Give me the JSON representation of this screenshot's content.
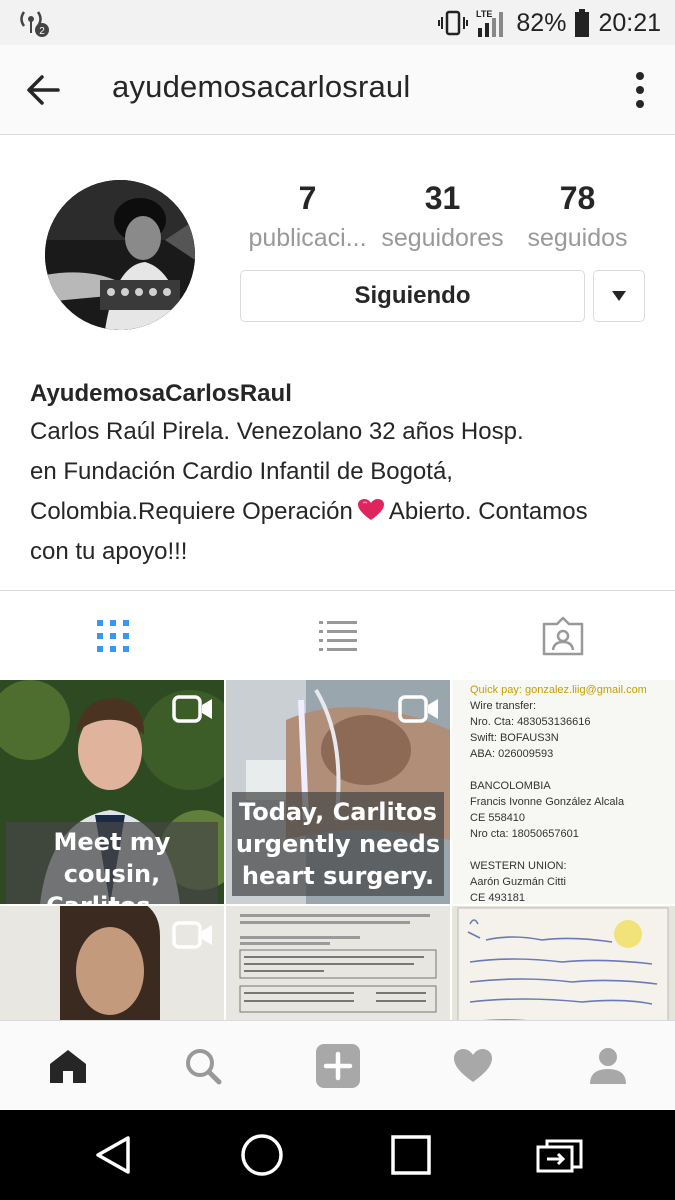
{
  "status_bar": {
    "battery": "82%",
    "time": "20:21",
    "network": "LTE",
    "hotspot_badge": "2"
  },
  "app_bar": {
    "title": "ayudemosacarlosraul",
    "back_icon": "arrow-left-icon",
    "more_icon": "vertical-dots-icon"
  },
  "profile": {
    "stats": [
      {
        "value": "7",
        "label": "publicaci..."
      },
      {
        "value": "31",
        "label": "seguidores"
      },
      {
        "value": "78",
        "label": "seguidos"
      }
    ],
    "follow_button": "Siguiendo",
    "name": "AyudemosaCarlosRaul",
    "bio_line1": "Carlos Raúl Pirela. Venezolano 32 años Hosp.",
    "bio_line2": "en Fundación Cardio Infantil de Bogotá,",
    "bio_line3a": "Colombia.Requiere Operación",
    "bio_line3b": "Abierto. Contamos",
    "bio_line4": "con tu apoyo!!!"
  },
  "tabs": [
    {
      "name": "grid-view",
      "icon": "grid-icon",
      "active": true
    },
    {
      "name": "list-view",
      "icon": "list-icon",
      "active": false
    },
    {
      "name": "tagged",
      "icon": "tagged-person-icon",
      "active": false
    }
  ],
  "posts": {
    "post1_caption": [
      "Meet my cousin,",
      "Carlitos..."
    ],
    "post2_caption": [
      "Today, Carlitos",
      "urgently needs",
      "heart surgery."
    ],
    "post3_lines": [
      "Quick pay: gonzalez.liig@gmail.com",
      "Wire transfer:",
      "Nro. Cta: 483053136616",
      "Swift: BOFAUS3N",
      "ABA: 026009593",
      "",
      "BANCOLOMBIA",
      "Francis Ivonne González Alcala",
      "CE 558410",
      "Nro cta: 18050657601",
      "",
      "WESTERN UNION:",
      "Aarón Guzmán Citti",
      "CE 493181"
    ]
  },
  "bottom_nav": [
    "home-icon",
    "search-icon",
    "add-post-icon",
    "activity-heart-icon",
    "profile-icon"
  ],
  "colors": {
    "accent_blue": "#3897f0",
    "text_dark": "#262626",
    "text_muted": "#999999",
    "border": "#dbdbdb",
    "heart_red": "#e0245e"
  }
}
